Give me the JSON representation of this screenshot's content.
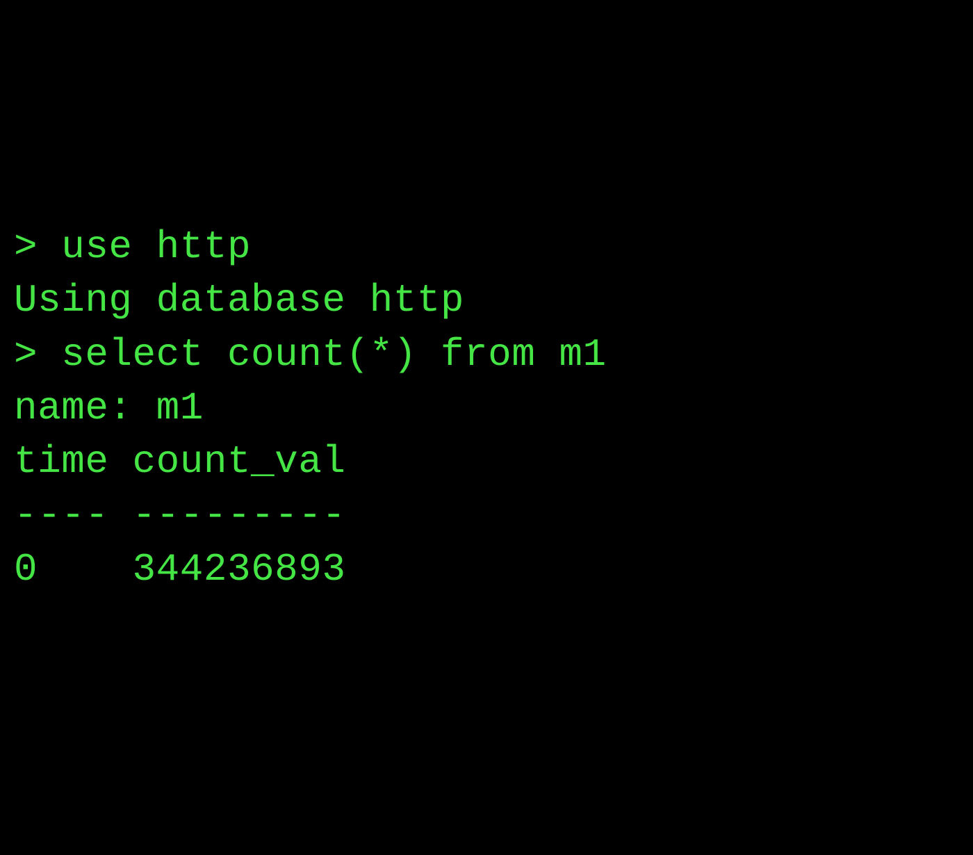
{
  "terminal": {
    "lines": [
      "> use http",
      "Using database http",
      "> select count(*) from m1",
      "name: m1",
      "time count_val",
      "---- ---------",
      "0    344236893"
    ]
  }
}
